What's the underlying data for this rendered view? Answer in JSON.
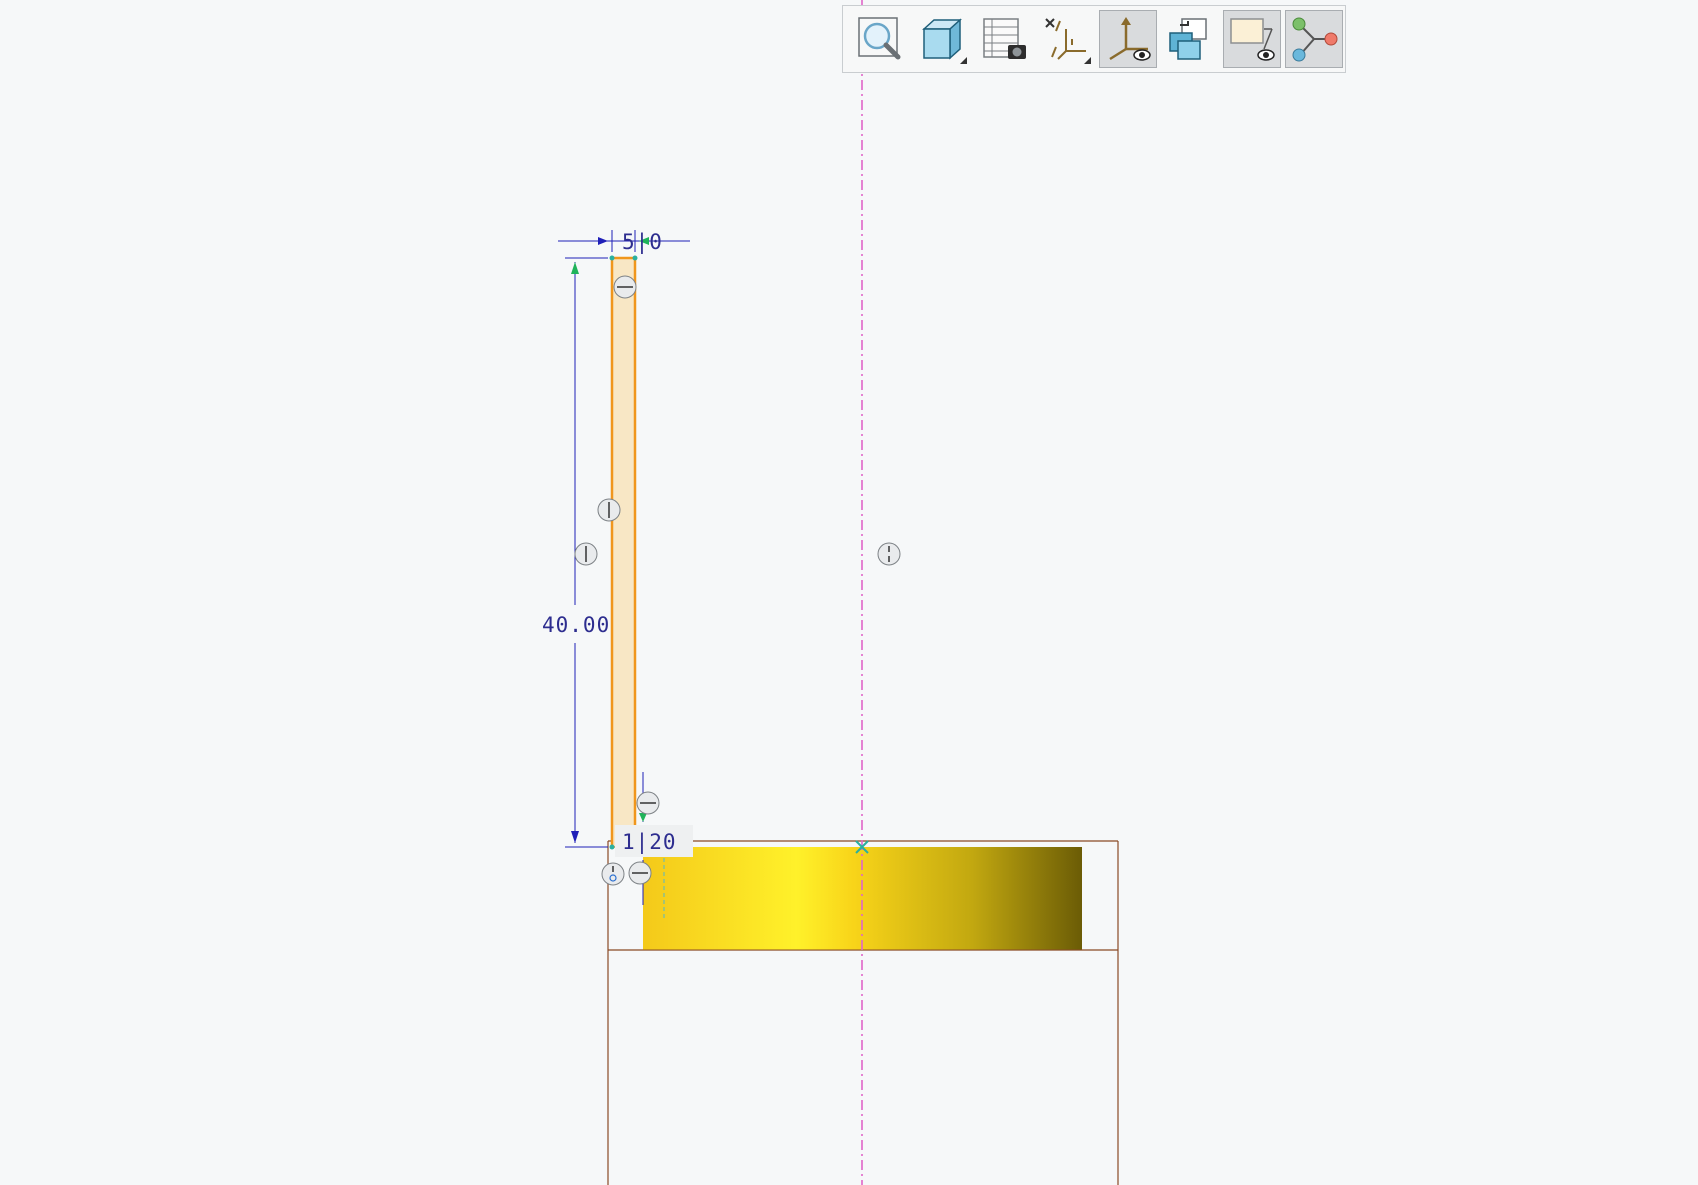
{
  "viewport": {
    "background": "#f6f8f9"
  },
  "graphics_toolbar": {
    "buttons": [
      {
        "id": "refit",
        "icon": "zoom-refit-icon",
        "active": false
      },
      {
        "id": "display-style",
        "icon": "display-style-cube-icon",
        "active": false,
        "has_dropdown": true
      },
      {
        "id": "saved-views",
        "icon": "saved-orientations-icon",
        "active": false
      },
      {
        "id": "datum-display",
        "icon": "datum-display-filters-icon",
        "active": false,
        "has_dropdown": true
      },
      {
        "id": "sketch-orientation",
        "icon": "sketch-view-icon",
        "active": true
      },
      {
        "id": "sketcher-display",
        "icon": "sketcher-display-filters-icon",
        "active": false
      },
      {
        "id": "annotation-display",
        "icon": "annotation-display-icon",
        "active": true
      },
      {
        "id": "references",
        "icon": "references-icon",
        "active": false
      }
    ]
  },
  "sketch": {
    "dimensions": {
      "top_width": "5|0",
      "height": "40.00",
      "bottom_step": "1|20"
    },
    "colors": {
      "profile": "#f0961c",
      "profile_fill": "#f8e7c5",
      "dimension": "#1f1fb8",
      "centerline": "#e066c8",
      "part_outline": "#8a4a26",
      "part_gold_light": "#fff12a",
      "part_gold_dark": "#6b5c06",
      "arrow_green": "#1fb35a"
    },
    "constraint_symbols": [
      "vertical-constraint-icon",
      "horizontal-constraint-icon"
    ]
  }
}
